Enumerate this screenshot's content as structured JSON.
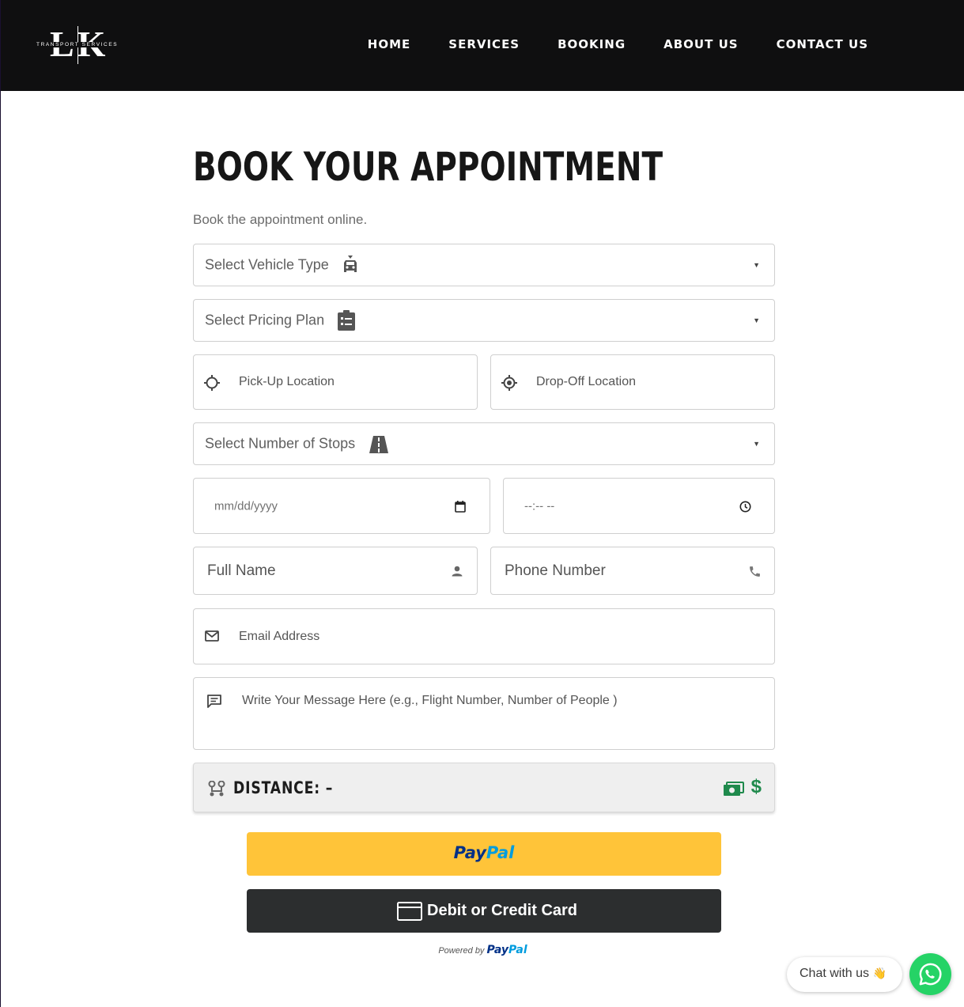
{
  "brand": {
    "logo_letters": "LK",
    "logo_subtitle": "TRANSPORT SERVICES"
  },
  "nav": {
    "items": [
      "HOME",
      "SERVICES",
      "BOOKING",
      "ABOUT US",
      "CONTACT US"
    ]
  },
  "main": {
    "title": "BOOK YOUR APPOINTMENT",
    "subtitle": "Book the appointment online."
  },
  "form": {
    "vehicle_type": {
      "placeholder": "Select Vehicle Type",
      "icon": "car-icon"
    },
    "pricing_plan": {
      "placeholder": "Select Pricing Plan",
      "icon": "clipboard-list-icon"
    },
    "pickup": {
      "placeholder": "Pick-Up Location",
      "icon": "crosshair-icon"
    },
    "dropoff": {
      "placeholder": "Drop-Off Location",
      "icon": "target-location-icon"
    },
    "stops": {
      "placeholder": "Select Number of Stops",
      "icon": "road-icon"
    },
    "date": {
      "placeholder": "mm/dd/yyyy",
      "icon": "calendar-icon"
    },
    "time": {
      "placeholder": "--:-- --",
      "icon": "clock-icon"
    },
    "full_name": {
      "placeholder": "Full Name",
      "icon": "person-icon"
    },
    "phone": {
      "placeholder": "Phone Number",
      "icon": "phone-icon"
    },
    "email": {
      "placeholder": "Email Address",
      "icon": "mail-icon"
    },
    "message": {
      "placeholder": "Write Your Message Here (e.g., Flight Number, Number of People )",
      "icon": "message-icon"
    }
  },
  "distance": {
    "label": "DISTANCE: –",
    "price_symbol": "$",
    "route_icon": "route-icon",
    "money_icon": "money-icon",
    "price_color": "#1f8a4c"
  },
  "payment": {
    "paypal_pay": "Pay",
    "paypal_pal": "Pal",
    "card_label": "Debit or Credit Card",
    "powered_by": "Powered by",
    "powered_pay": "Pay",
    "powered_pal": "Pal",
    "paypal_color": "#ffc439",
    "card_color": "#2c2e2f"
  },
  "chat": {
    "label": "Chat with us",
    "emoji": "👋",
    "whatsapp_color": "#25d366"
  }
}
